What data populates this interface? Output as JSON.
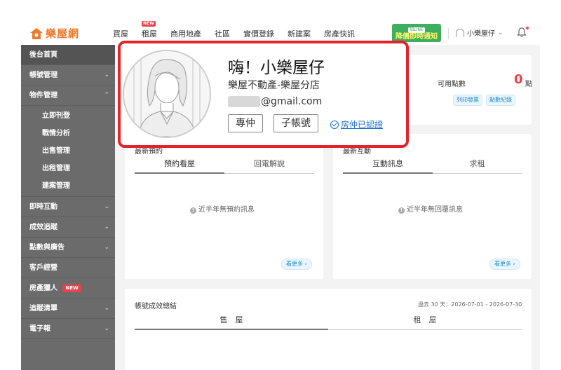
{
  "brand": {
    "name": "樂屋網",
    "color": "#ee7a2b"
  },
  "nav": {
    "items": [
      "買屋",
      "租屋",
      "商用地產",
      "社區",
      "實價登錄",
      "新建案",
      "房產快訊"
    ],
    "new_badge": "NEW",
    "line_tag": "加LINE",
    "line_msg": "降價即時通知",
    "user_name": "小樂屋仔"
  },
  "sidebar": {
    "home": "後台首頁",
    "account": "帳號管理",
    "property": "物件管理",
    "property_sub": [
      "立即刊登",
      "戰情分析",
      "出售管理",
      "出租管理",
      "建案管理"
    ],
    "instant": "即時互動",
    "tracking": "成效追蹤",
    "points_ads": "點數與廣告",
    "customers": "客戶經營",
    "hunter": "房產獵人",
    "hunter_badge": "NEW",
    "track_list": "追蹤清單",
    "newsletter": "電子報"
  },
  "points": {
    "label": "可用點數",
    "value": "0",
    "unit": "點",
    "print_invoice": "列印發票",
    "point_records": "點數紀錄"
  },
  "booking_card": {
    "title": "最新預約",
    "tab_active": "預約看屋",
    "tab_inactive": "回電解說",
    "empty": "近半年無預約訊息",
    "more": "看更多"
  },
  "interaction_card": {
    "title": "最新互動",
    "tab_active": "互動訊息",
    "tab_inactive": "求租",
    "empty": "近半年無回覆訊息",
    "more": "看更多"
  },
  "summary": {
    "title": "帳號成效總結",
    "range": "過去 30 天：2026-07-01 - 2026-07-30",
    "tab_sale": "售　屋",
    "tab_rent": "租　屋"
  },
  "profile": {
    "greeting": "嗨！小樂屋仔",
    "company": "樂屋不動產-樂屋分店",
    "email_domain": "@gmail.com",
    "role": "專仲",
    "sub_account": "子帳號",
    "verified": "房仲已認證"
  },
  "colors": {
    "accent_red": "#e3232b",
    "link_blue": "#1a6fcf",
    "sidebar": "#6b6b6b"
  },
  "icons": [
    "house-logo-icon",
    "headset-icon",
    "chevron-down-icon",
    "bell-icon",
    "info-icon",
    "check-circle-icon",
    "chevron-right-icon"
  ]
}
